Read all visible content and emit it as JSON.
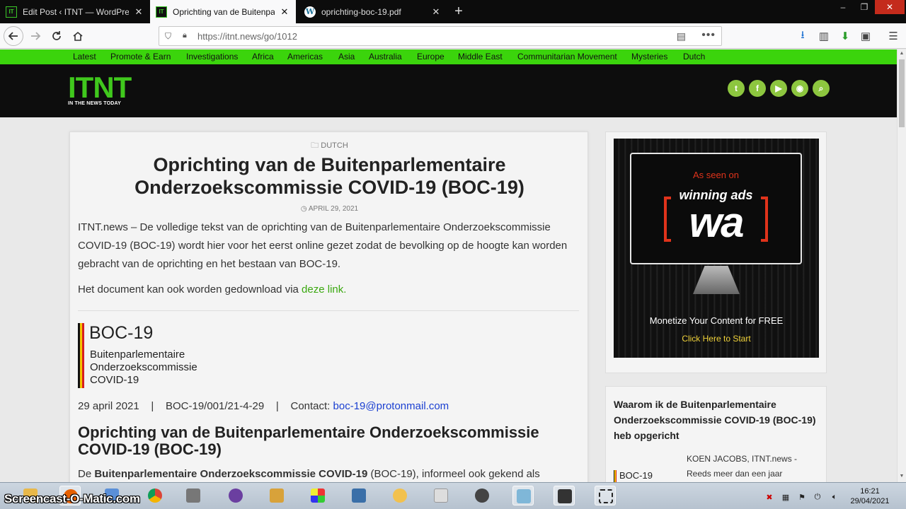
{
  "browser": {
    "tabs": [
      {
        "title": "Edit Post ‹ ITNT — WordPress",
        "favicon": "itnt-favicon",
        "active": false
      },
      {
        "title": "Oprichting van de Buitenparlementaire",
        "favicon": "itnt-favicon",
        "active": true
      },
      {
        "title": "oprichting-boc-19.pdf",
        "favicon": "wordpress-favicon",
        "active": false
      }
    ],
    "new_tab_symbol": "+",
    "url": "https://itnt.news/go/1012",
    "window_controls": {
      "minimize": "–",
      "maximize": "❐",
      "close": "✕"
    }
  },
  "site": {
    "menu": [
      "Latest",
      "Promote & Earn",
      "Investigations",
      "Africa",
      "Americas",
      "Asia",
      "Australia",
      "Europe",
      "Middle East",
      "Communitarian Movement",
      "Mysteries",
      "Dutch"
    ],
    "logo_text": "ITNT",
    "logo_tagline": "IN THE NEWS TODAY",
    "social": [
      "twitter-icon",
      "facebook-icon",
      "youtube-icon",
      "rss-icon",
      "search-icon"
    ],
    "accent": "#3bd40c"
  },
  "article": {
    "category": "DUTCH",
    "title": "Oprichting van de Buitenparlementaire Onderzoekscommissie COVID-19 (BOC-19)",
    "date": "APRIL 29, 2021",
    "intro": "ITNT.news – De volledige tekst van de oprichting van de Buitenparlementaire Onderzoekscommissie COVID-19 (BOC-19) wordt hier voor het eerst online gezet zodat de bevolking op de hoogte kan worden gebracht van de oprichting en het bestaan van BOC-19.",
    "download_prefix": "Het document kan ook worden gedownload via ",
    "download_link": "deze link.",
    "doc_logo_title": "BOC-19",
    "doc_logo_lines": [
      "Buitenparlementaire",
      "Onderzoekscommissie",
      "COVID-19"
    ],
    "meta_date": "29 april 2021",
    "meta_ref": "BOC-19/001/21-4-29",
    "meta_contact_label": "Contact:",
    "meta_email": "boc-19@protonmail.com",
    "heading": "Oprichting van de Buitenparlementaire Onderzoekscommissie COVID-19 (BOC-19)",
    "body_prefix": "De ",
    "body_bold": "Buitenparlementaire Onderzoekscommissie COVID-19",
    "body_suffix": " (BOC-19), informeel ook gekend als"
  },
  "ad": {
    "seen_on": "As seen on",
    "brand": "winning ads",
    "brand_mark": "wa",
    "tagline": "Monetize Your Content for FREE",
    "cta": "Click Here to Start"
  },
  "sidebar_post": {
    "title": "Waarom ik de Buitenparlementaire Onderzoekscommissie COVID-19 (BOC-19) heb opgericht",
    "thumb_text": "BOC-19",
    "excerpt_line1": "KOEN JACOBS, ITNT.news -",
    "excerpt_line2": "Reeds meer dan een jaar"
  },
  "taskbar": {
    "watermark": "Screencast-O-Matic.com",
    "time": "16:21",
    "date": "29/04/2021"
  }
}
